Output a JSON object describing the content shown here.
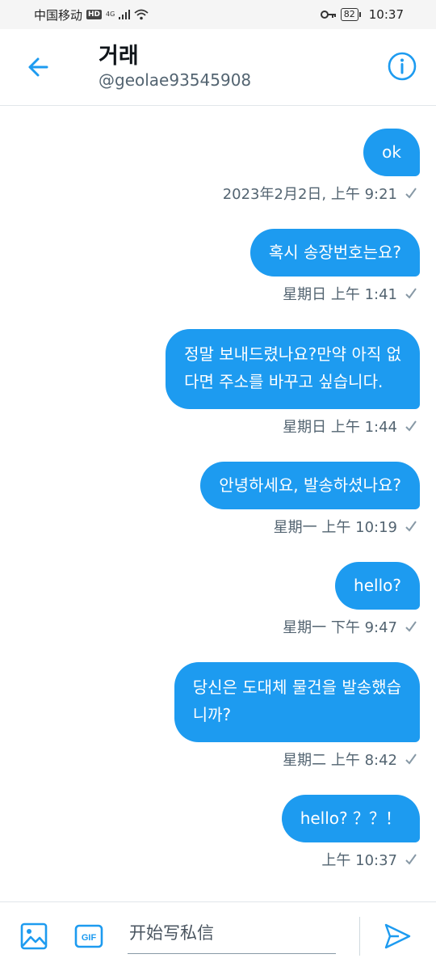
{
  "status_bar": {
    "carrier": "中国移动",
    "hd": "HD",
    "network": "4G",
    "battery": "82",
    "time": "10:37"
  },
  "header": {
    "title": "거래",
    "handle": "@geolae93545908",
    "back_icon": "arrow-left-icon",
    "info_icon": "info-circle-icon"
  },
  "messages": [
    {
      "text": "ok",
      "timestamp": "2023年2月2日, 上午 9:21"
    },
    {
      "text": "혹시 송장번호는요?",
      "timestamp": "星期日 上午 1:41"
    },
    {
      "lines": [
        "정말 보내드렸나요?만약 아직 없",
        "다면 주소를 바꾸고 싶습니다."
      ],
      "timestamp": "星期日 上午 1:44"
    },
    {
      "text": "안녕하세요, 발송하셨나요?",
      "timestamp": "星期一 上午 10:19"
    },
    {
      "text": "hello?",
      "timestamp": "星期一 下午 9:47"
    },
    {
      "lines": [
        "당신은 도대체 물건을 발송했습",
        "니까?"
      ],
      "timestamp": "星期二 上午 8:42"
    },
    {
      "text": "hello? ？？！",
      "timestamp": "上午 10:37"
    }
  ],
  "composer": {
    "placeholder": "开始写私信",
    "gif_label": "GIF"
  },
  "colors": {
    "accent": "#1d9bf0",
    "muted": "#536471"
  }
}
